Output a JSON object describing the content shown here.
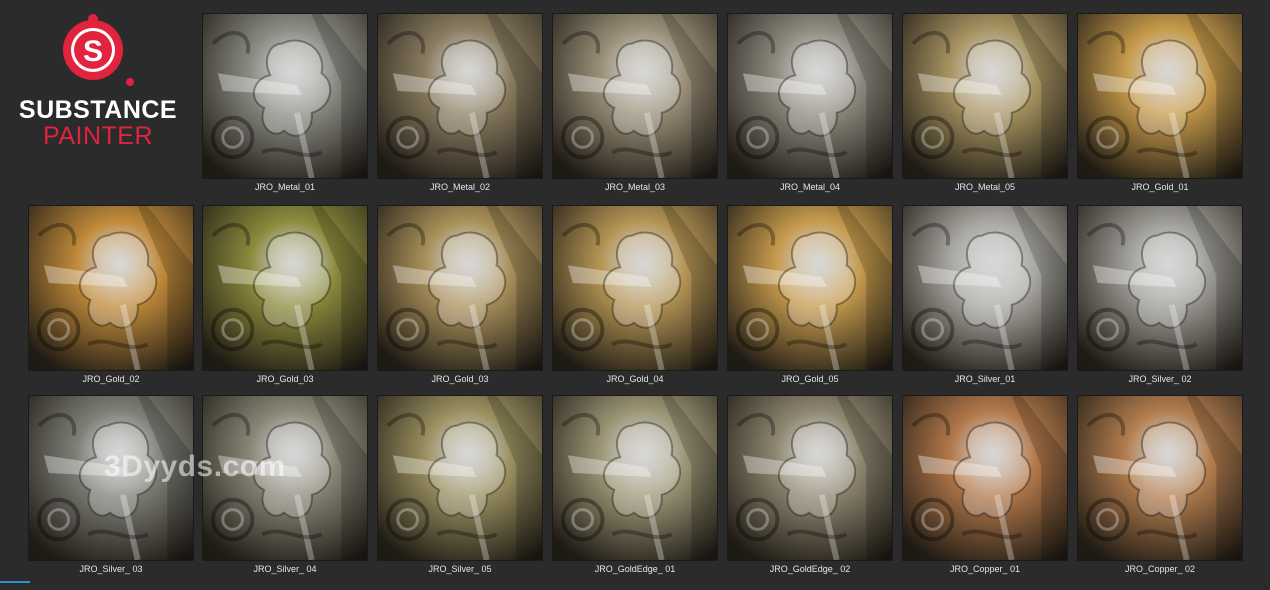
{
  "logo": {
    "line1": "SUBSTANCE",
    "line2": "PAINTER",
    "icon": "substance-s-icon",
    "colors": {
      "primary": "#e2233d",
      "text": "#ffffff"
    }
  },
  "watermark": "3Dyyds.com",
  "materials": [
    {
      "label": "JRO_Metal_01",
      "tint": "#8c8c85"
    },
    {
      "label": "JRO_Metal_02",
      "tint": "#8a7c60"
    },
    {
      "label": "JRO_Metal_03",
      "tint": "#9a8f78"
    },
    {
      "label": "JRO_Metal_04",
      "tint": "#8f8a7f"
    },
    {
      "label": "JRO_Metal_05",
      "tint": "#a89462"
    },
    {
      "label": "JRO_Gold_01",
      "tint": "#c69a4a"
    },
    {
      "label": "JRO_Gold_02",
      "tint": "#c08a3a"
    },
    {
      "label": "JRO_Gold_03",
      "tint": "#8c8a3c"
    },
    {
      "label": "JRO_Gold_03",
      "tint": "#a9905a"
    },
    {
      "label": "JRO_Gold_04",
      "tint": "#b49454"
    },
    {
      "label": "JRO_Gold_05",
      "tint": "#c59a4c"
    },
    {
      "label": "JRO_Silver_01",
      "tint": "#a8a6a0"
    },
    {
      "label": "JRO_Silver_ 02",
      "tint": "#9c9a94"
    },
    {
      "label": "JRO_Silver_ 03",
      "tint": "#7f7f78"
    },
    {
      "label": "JRO_Silver_ 04",
      "tint": "#8a8778"
    },
    {
      "label": "JRO_Silver_ 05",
      "tint": "#9a9060"
    },
    {
      "label": "JRO_GoldEdge_ 01",
      "tint": "#9c9676"
    },
    {
      "label": "JRO_GoldEdge_ 02",
      "tint": "#8e8670"
    },
    {
      "label": "JRO_Copper_ 01",
      "tint": "#b2784a"
    },
    {
      "label": "JRO_Copper_ 02",
      "tint": "#b27d4e"
    }
  ]
}
